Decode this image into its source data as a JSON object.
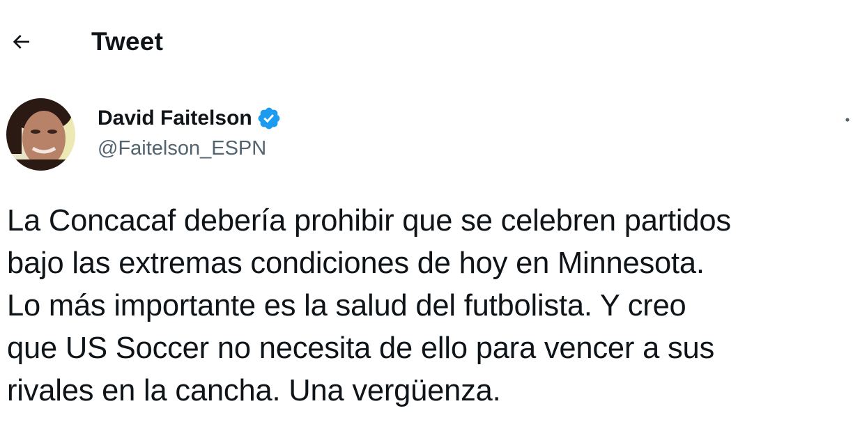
{
  "header": {
    "back_icon": "arrow-left-icon",
    "title": "Tweet"
  },
  "author": {
    "display_name": "David Faitelson",
    "handle": "@Faitelson_ESPN",
    "verified_icon": "verified-badge-icon",
    "more_icon": "more-horizontal-icon"
  },
  "tweet": {
    "text": "La Concacaf debería prohibir que se celebren partidos\nbajo las extremas condiciones de hoy en Minnesota.\nLo más importante es la salud del futbolista. Y creo\nque US Soccer no necesita de ello para vencer a sus\nrivales en la cancha. Una vergüenza."
  },
  "colors": {
    "text": "#0f1419",
    "secondary": "#536471",
    "verified": "#1d9bf0",
    "background": "#ffffff"
  }
}
